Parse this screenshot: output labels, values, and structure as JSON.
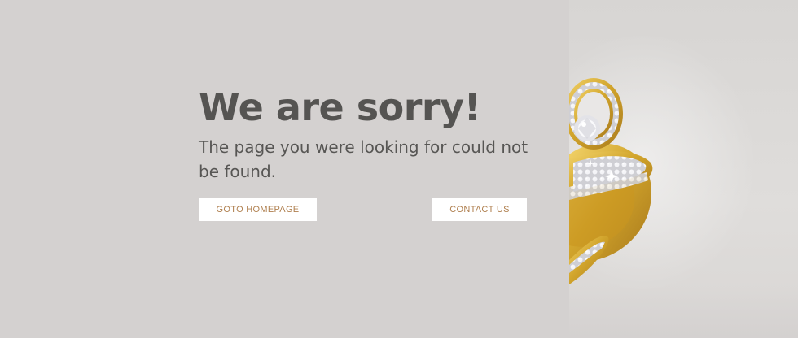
{
  "error": {
    "headline": "We are sorry!",
    "message": "The page you were looking for could not be found."
  },
  "actions": {
    "homepage_label": "GOTO HOMEPAGE",
    "contact_label": "CONTACT US"
  },
  "colors": {
    "background": "#d4d1d0",
    "headline_text": "#555452",
    "button_text": "#b08050",
    "button_bg": "#ffffff",
    "gold": "#d9b23a"
  },
  "hero_image": {
    "icon": "jewelry-rings-icon"
  }
}
